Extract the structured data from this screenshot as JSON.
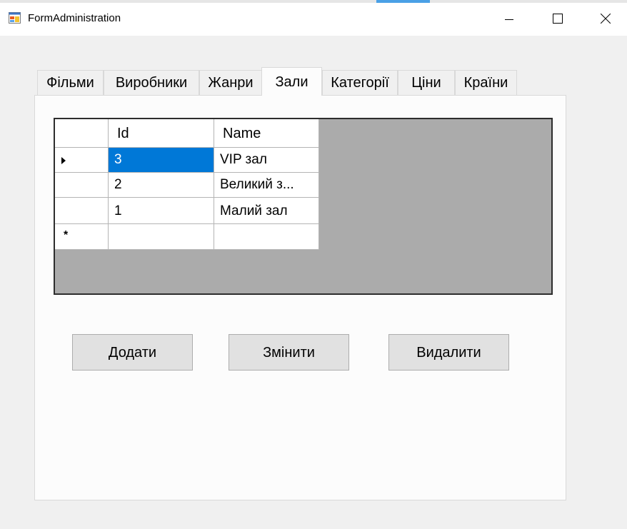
{
  "window": {
    "title": "FormAdministration",
    "icon": "app-form-icon",
    "controls": [
      "minimize-icon",
      "maximize-icon",
      "close-icon"
    ]
  },
  "tabs": [
    {
      "label": "Фільми",
      "active": false
    },
    {
      "label": "Виробники",
      "active": false
    },
    {
      "label": "Жанри",
      "active": false
    },
    {
      "label": "Зали",
      "active": true
    },
    {
      "label": "Категорії",
      "active": false
    },
    {
      "label": "Ціни",
      "active": false
    },
    {
      "label": "Країни",
      "active": false
    }
  ],
  "grid": {
    "columns": [
      "Id",
      "Name"
    ],
    "rows": [
      {
        "id": "3",
        "name": "VIP зал",
        "selected": true,
        "current": true
      },
      {
        "id": "2",
        "name": "Великий з...",
        "selected": false,
        "current": false
      },
      {
        "id": "1",
        "name": "Малий зал",
        "selected": false,
        "current": false
      }
    ],
    "new_row_marker": "*",
    "selection_color": "#0078d7"
  },
  "buttons": {
    "add": "Додати",
    "edit": "Змінити",
    "delete": "Видалити"
  }
}
